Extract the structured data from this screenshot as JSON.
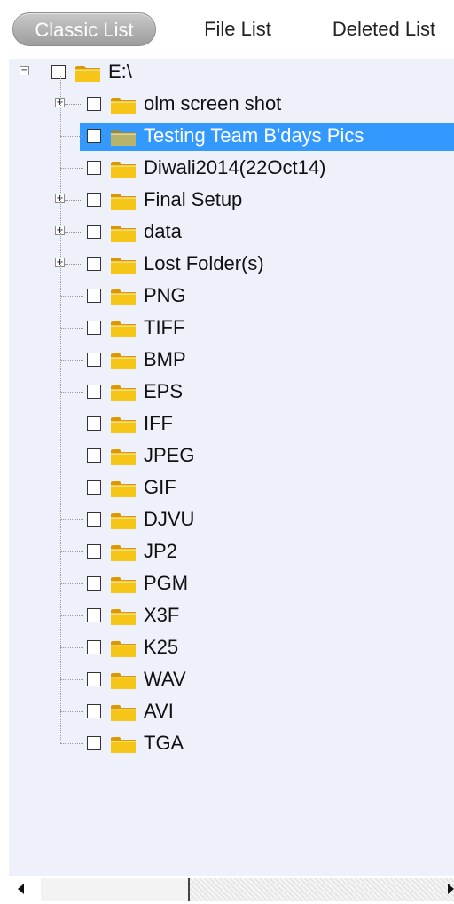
{
  "tabs": [
    {
      "label": "Classic List",
      "active": true
    },
    {
      "label": "File List",
      "active": false
    },
    {
      "label": "Deleted List",
      "active": false
    }
  ],
  "tree": {
    "root": {
      "label": "E:\\",
      "expanded": true
    },
    "items": [
      {
        "label": "olm screen shot",
        "expandable": true
      },
      {
        "label": "Testing Team B'days Pics",
        "expandable": false,
        "selected": true
      },
      {
        "label": "Diwali2014(22Oct14)",
        "expandable": false
      },
      {
        "label": "Final Setup",
        "expandable": true
      },
      {
        "label": "data",
        "expandable": true
      },
      {
        "label": "Lost Folder(s)",
        "expandable": true
      },
      {
        "label": "PNG",
        "expandable": false
      },
      {
        "label": "TIFF",
        "expandable": false
      },
      {
        "label": "BMP",
        "expandable": false
      },
      {
        "label": "EPS",
        "expandable": false
      },
      {
        "label": "IFF",
        "expandable": false
      },
      {
        "label": "JPEG",
        "expandable": false
      },
      {
        "label": "GIF",
        "expandable": false
      },
      {
        "label": "DJVU",
        "expandable": false
      },
      {
        "label": "JP2",
        "expandable": false
      },
      {
        "label": "PGM",
        "expandable": false
      },
      {
        "label": "X3F",
        "expandable": false
      },
      {
        "label": "K25",
        "expandable": false
      },
      {
        "label": "WAV",
        "expandable": false
      },
      {
        "label": "AVI",
        "expandable": false
      },
      {
        "label": "TGA",
        "expandable": false
      }
    ]
  },
  "icons": {
    "expand": "plus-box-icon",
    "collapse": "minus-box-icon",
    "folder": "folder-icon",
    "scroll_left": "arrow-left-icon",
    "scroll_right": "arrow-right-icon"
  },
  "colors": {
    "tree_bg": "#eef0fa",
    "selection": "#3399ff",
    "folder": "#f5c518",
    "folder_selected": "#b8b36a"
  }
}
